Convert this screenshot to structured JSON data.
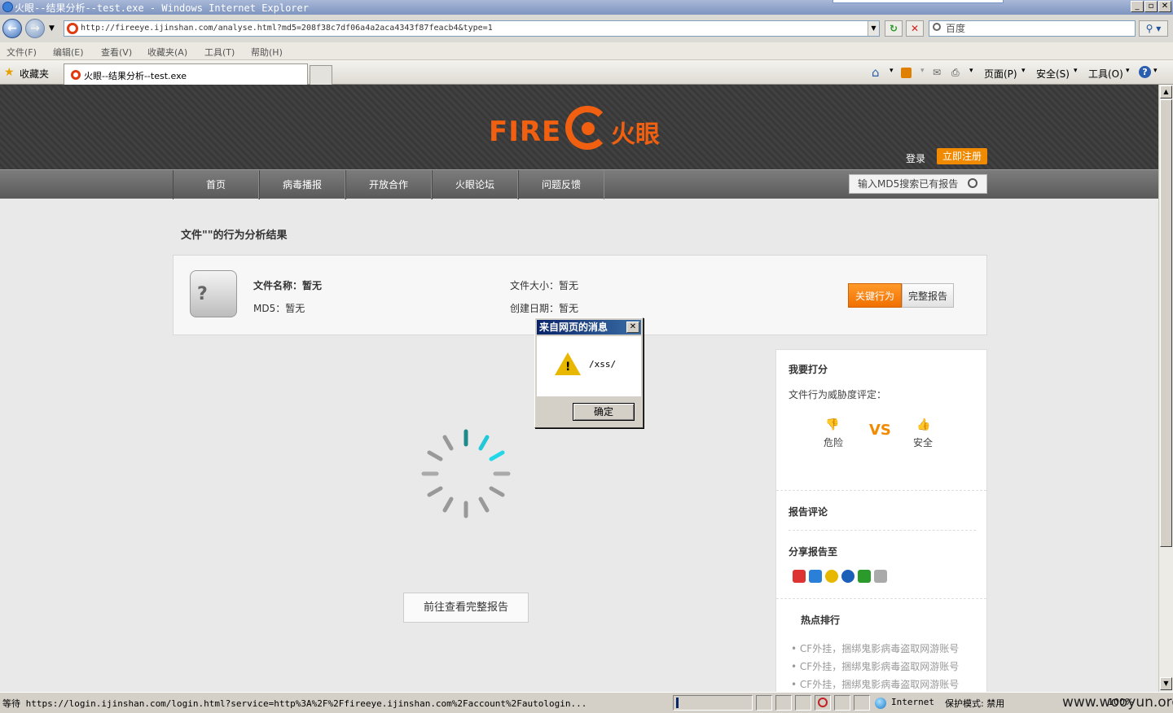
{
  "window": {
    "title": "火眼--结果分析--test.exe - Windows Internet Explorer",
    "controls": {
      "minimize": "_",
      "restore": "▫",
      "close": "✕"
    }
  },
  "address_bar": {
    "url": "http://fireeye.ijinshan.com/analyse.html?md5=208f38c7df06a4a2aca4343f87feacb4&type=1",
    "back": "←",
    "forward": "→",
    "refresh": "↻",
    "stop": "✕",
    "search_placeholder": "百度"
  },
  "menu": [
    "文件(F)",
    "编辑(E)",
    "查看(V)",
    "收藏夹(A)",
    "工具(T)",
    "帮助(H)"
  ],
  "favorites": {
    "label": "收藏夹",
    "tab_title": "火眼--结果分析--test.exe"
  },
  "command_bar": {
    "page": "页面(P)",
    "safety": "安全(S)",
    "tools": "工具(O)",
    "help": "?"
  },
  "site": {
    "logo_fire": "FIRE",
    "logo_cn": "火眼",
    "login": "登录",
    "register": "立即注册",
    "nav": [
      "首页",
      "病毒播报",
      "开放合作",
      "火眼论坛",
      "问题反馈"
    ],
    "md5_search_placeholder": "输入MD5搜索已有报告"
  },
  "result": {
    "title": "文件\"\"的行为分析结果",
    "file_icon": "?",
    "file_name": "文件名称：暂无",
    "md5": "MD5：暂无",
    "file_size": "文件大小：暂无",
    "created": "创建日期：暂无",
    "key_behavior": "关键行为",
    "full_report": "完整报告",
    "goto_full_report": "前往查看完整报告"
  },
  "sidebar": {
    "rate_title": "我要打分",
    "rate_desc": "文件行为威胁度评定：",
    "danger": "危险",
    "vs": "VS",
    "safe": "安全",
    "comments_title": "报告评论",
    "share_title": "分享报告至",
    "share_colors": [
      "#d33",
      "#2a7fd8",
      "#e8b800",
      "#1c5fb8",
      "#2a9a2a",
      "#aaa"
    ],
    "hot_title": "热点排行",
    "hot_items": [
      "CF外挂，捆绑鬼影病毒盗取网游账号",
      "CF外挂，捆绑鬼影病毒盗取网游账号",
      "CF外挂，捆绑鬼影病毒盗取网游账号"
    ]
  },
  "dialog": {
    "title": "来自网页的消息",
    "message": "/xss/",
    "ok": "确定",
    "warn_mark": "!"
  },
  "status_bar": {
    "text": "等待 https://login.ijinshan.com/login.html?service=http%3A%2F%2Ffireeye.ijinshan.com%2Faccount%2Fautologin...",
    "zone": "Internet",
    "protected_mode": "保护模式: 禁用",
    "zoom": "100%"
  },
  "watermark": "www.wooyun.org"
}
